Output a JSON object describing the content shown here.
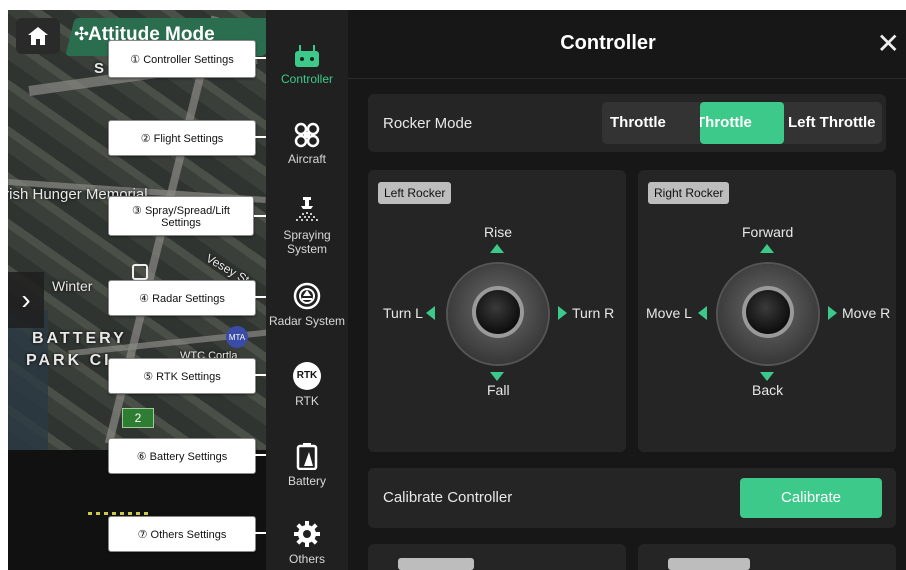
{
  "map": {
    "mode_label": "Attitude Mode",
    "labels": [
      "Irish Hunger Memorial",
      "Winter",
      "BATTERY",
      "PARK CI",
      "WTC Cortla",
      "Vesey St",
      "S",
      "St"
    ],
    "badge_number": "2",
    "map_icon_text": "MTA"
  },
  "callouts": [
    "① Controller Settings",
    "② Flight Settings",
    "③ Spray/Spread/Lift Settings",
    "④ Radar Settings",
    "⑤ RTK Settings",
    "⑥ Battery Settings",
    "⑦ Others Settings"
  ],
  "sidebar": {
    "items": [
      {
        "label": "Controller",
        "icon": "controller-icon",
        "active": true
      },
      {
        "label": "Aircraft",
        "icon": "aircraft-icon"
      },
      {
        "label": "Spraying System",
        "icon": "spraying-icon"
      },
      {
        "label": "Radar System",
        "icon": "radar-icon"
      },
      {
        "label": "RTK",
        "icon": "rtk-icon",
        "icon_text": "RTK"
      },
      {
        "label": "Battery",
        "icon": "battery-icon"
      },
      {
        "label": "Others",
        "icon": "gear-icon"
      }
    ]
  },
  "panel": {
    "title": "Controller",
    "rocker_mode": {
      "label": "Rocker Mode",
      "options": [
        "Throttle",
        "Throttle",
        "Left Throttle"
      ],
      "selected_index": 1
    },
    "left_rocker": {
      "tag": "Left Rocker",
      "up": "Rise",
      "down": "Fall",
      "left": "Turn L",
      "right": "Turn R"
    },
    "right_rocker": {
      "tag": "Right Rocker",
      "up": "Forward",
      "down": "Back",
      "left": "Move L",
      "right": "Move R"
    },
    "calibrate": {
      "label": "Calibrate Controller",
      "button": "Calibrate"
    }
  },
  "colors": {
    "accent": "#3cc98a",
    "panel_bg": "#171717",
    "card_bg": "#252525"
  }
}
